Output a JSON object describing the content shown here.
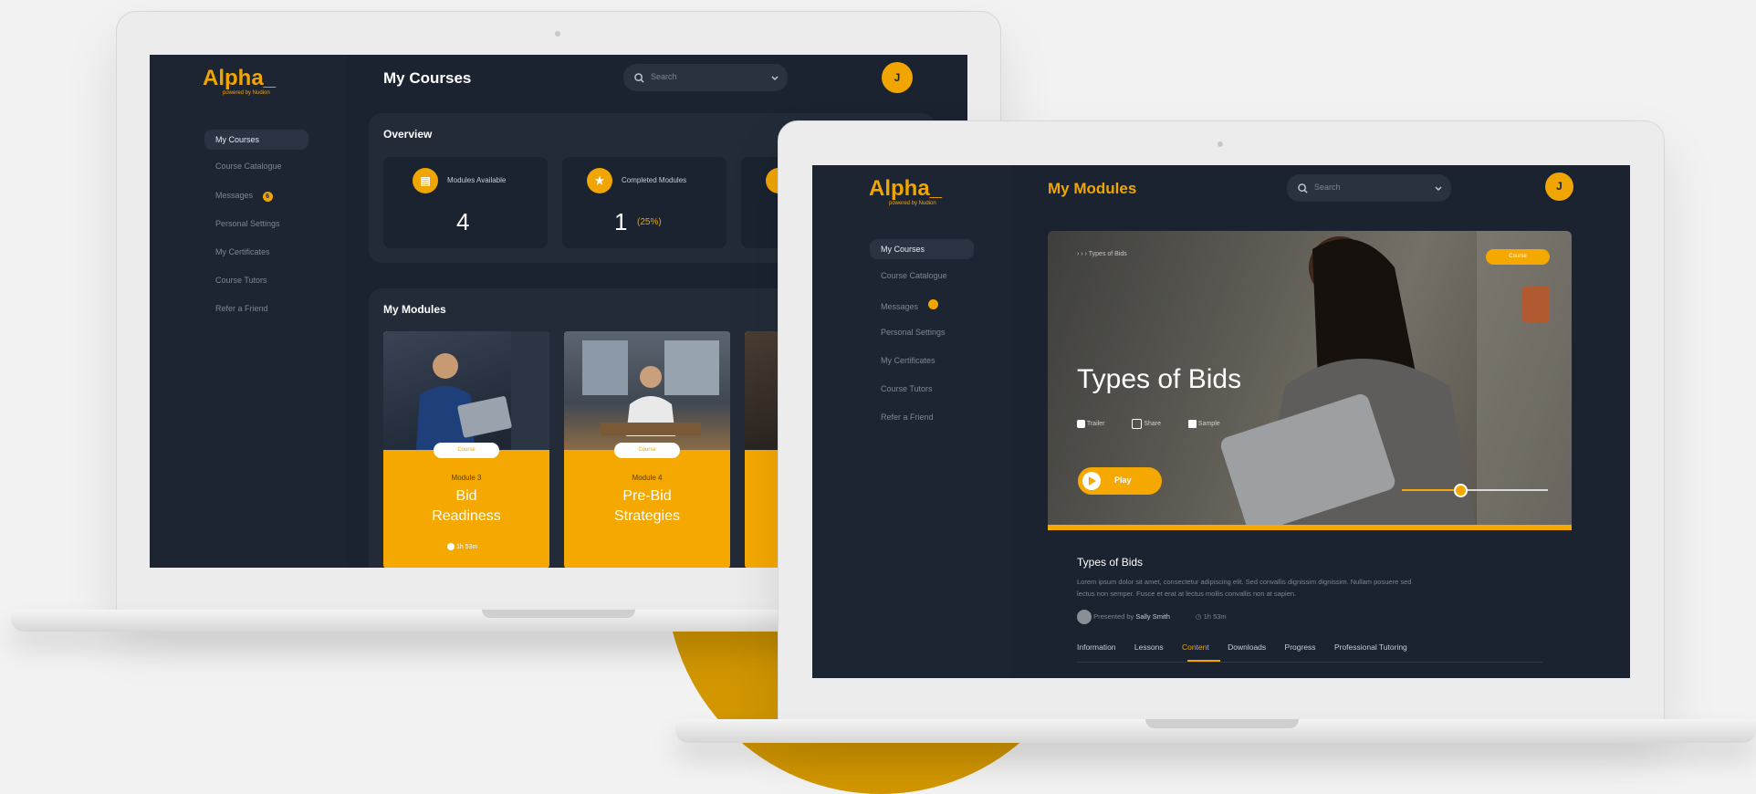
{
  "laptop_back": {
    "logo": "Alpha_",
    "logo_sub": "powered by Nudion",
    "page_title": "My Courses",
    "search_placeholder": "Search",
    "avatar_initial": "J",
    "nav": [
      {
        "label": "My Courses",
        "active": true
      },
      {
        "label": "Course Catalogue"
      },
      {
        "label": "Messages",
        "badge": "6"
      },
      {
        "label": "Personal Settings"
      },
      {
        "label": "My Certificates"
      },
      {
        "label": "Course Tutors"
      },
      {
        "label": "Refer a Friend"
      }
    ],
    "overview": {
      "title": "Overview",
      "stats": [
        {
          "label": "Modules Available",
          "value": "4",
          "icon": "document-icon"
        },
        {
          "label": "Completed Modules",
          "value": "1",
          "extra": "(25%)",
          "icon": "star-icon"
        }
      ]
    },
    "modules": {
      "title": "My Modules",
      "cards": [
        {
          "pill": "Course",
          "number": "Module 3",
          "title_line1": "Bid",
          "title_line2": "Readiness",
          "duration": "1h 53m"
        },
        {
          "pill": "Course",
          "number": "Module 4",
          "title_line1": "Pre-Bid",
          "title_line2": "Strategies"
        }
      ]
    }
  },
  "laptop_front": {
    "logo": "Alpha_",
    "logo_sub": "powered by Nudion",
    "page_title": "My Modules",
    "search_placeholder": "Search",
    "avatar_initial": "J",
    "nav": [
      {
        "label": "My Courses",
        "active": true
      },
      {
        "label": "Course Catalogue"
      },
      {
        "label": "Messages",
        "badge": ""
      },
      {
        "label": "Personal Settings"
      },
      {
        "label": "My Certificates"
      },
      {
        "label": "Course Tutors"
      },
      {
        "label": "Refer a Friend"
      }
    ],
    "hero": {
      "breadcrumb_current": "Types of Bids",
      "pill": "Course",
      "title": "Types of Bids",
      "actions": [
        "Trailer",
        "Share",
        "Sample"
      ],
      "play_label": "Play",
      "progress": 0.4
    },
    "details": {
      "title": "Types of Bids",
      "description_line1": "Lorem ipsum dolor sit amet, consectetur adipiscing elit. Sed convallis dignissim dignissim. Nullam posuere sed",
      "description_line2": "lectus non semper. Fusce et erat at lectus mollis convallis non at sapien.",
      "presenter_prefix": "Presented by",
      "presenter_name": "Sally Smith",
      "duration": "1h 53m",
      "tabs": [
        {
          "label": "Information"
        },
        {
          "label": "Lessons"
        },
        {
          "label": "Content",
          "active": true
        },
        {
          "label": "Downloads"
        },
        {
          "label": "Progress"
        },
        {
          "label": "Professional Tutoring"
        }
      ]
    }
  },
  "colors": {
    "accent": "#f0a500",
    "background": "#1b2230",
    "sidebar": "#1e2532"
  }
}
